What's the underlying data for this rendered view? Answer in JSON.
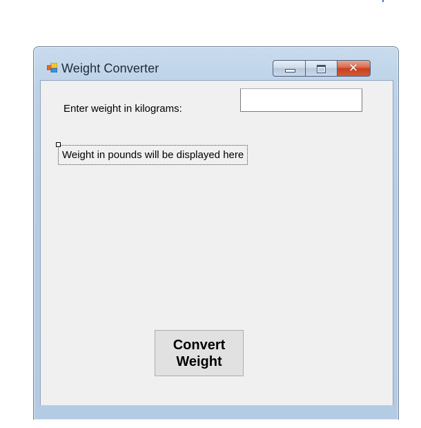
{
  "window": {
    "title": "Weight Converter",
    "icon": "winforms-app-icon",
    "controls": {
      "minimize_icon": "minimize-icon",
      "maximize_icon": "maximize-icon",
      "close_icon": "close-icon",
      "close_glyph": "✕",
      "close_color": "#c7401e"
    }
  },
  "form": {
    "kg_label": "Enter weight in kilograms:",
    "kg_input_value": "",
    "kg_input_placeholder": "",
    "output_label": "Weight in pounds will be displayed here",
    "convert_button_label": "Convert\nWeight"
  },
  "colors": {
    "client_background": "#f0f0f0",
    "frame_tint": "#b9cfe7",
    "button_face": "#e1e1e1"
  }
}
